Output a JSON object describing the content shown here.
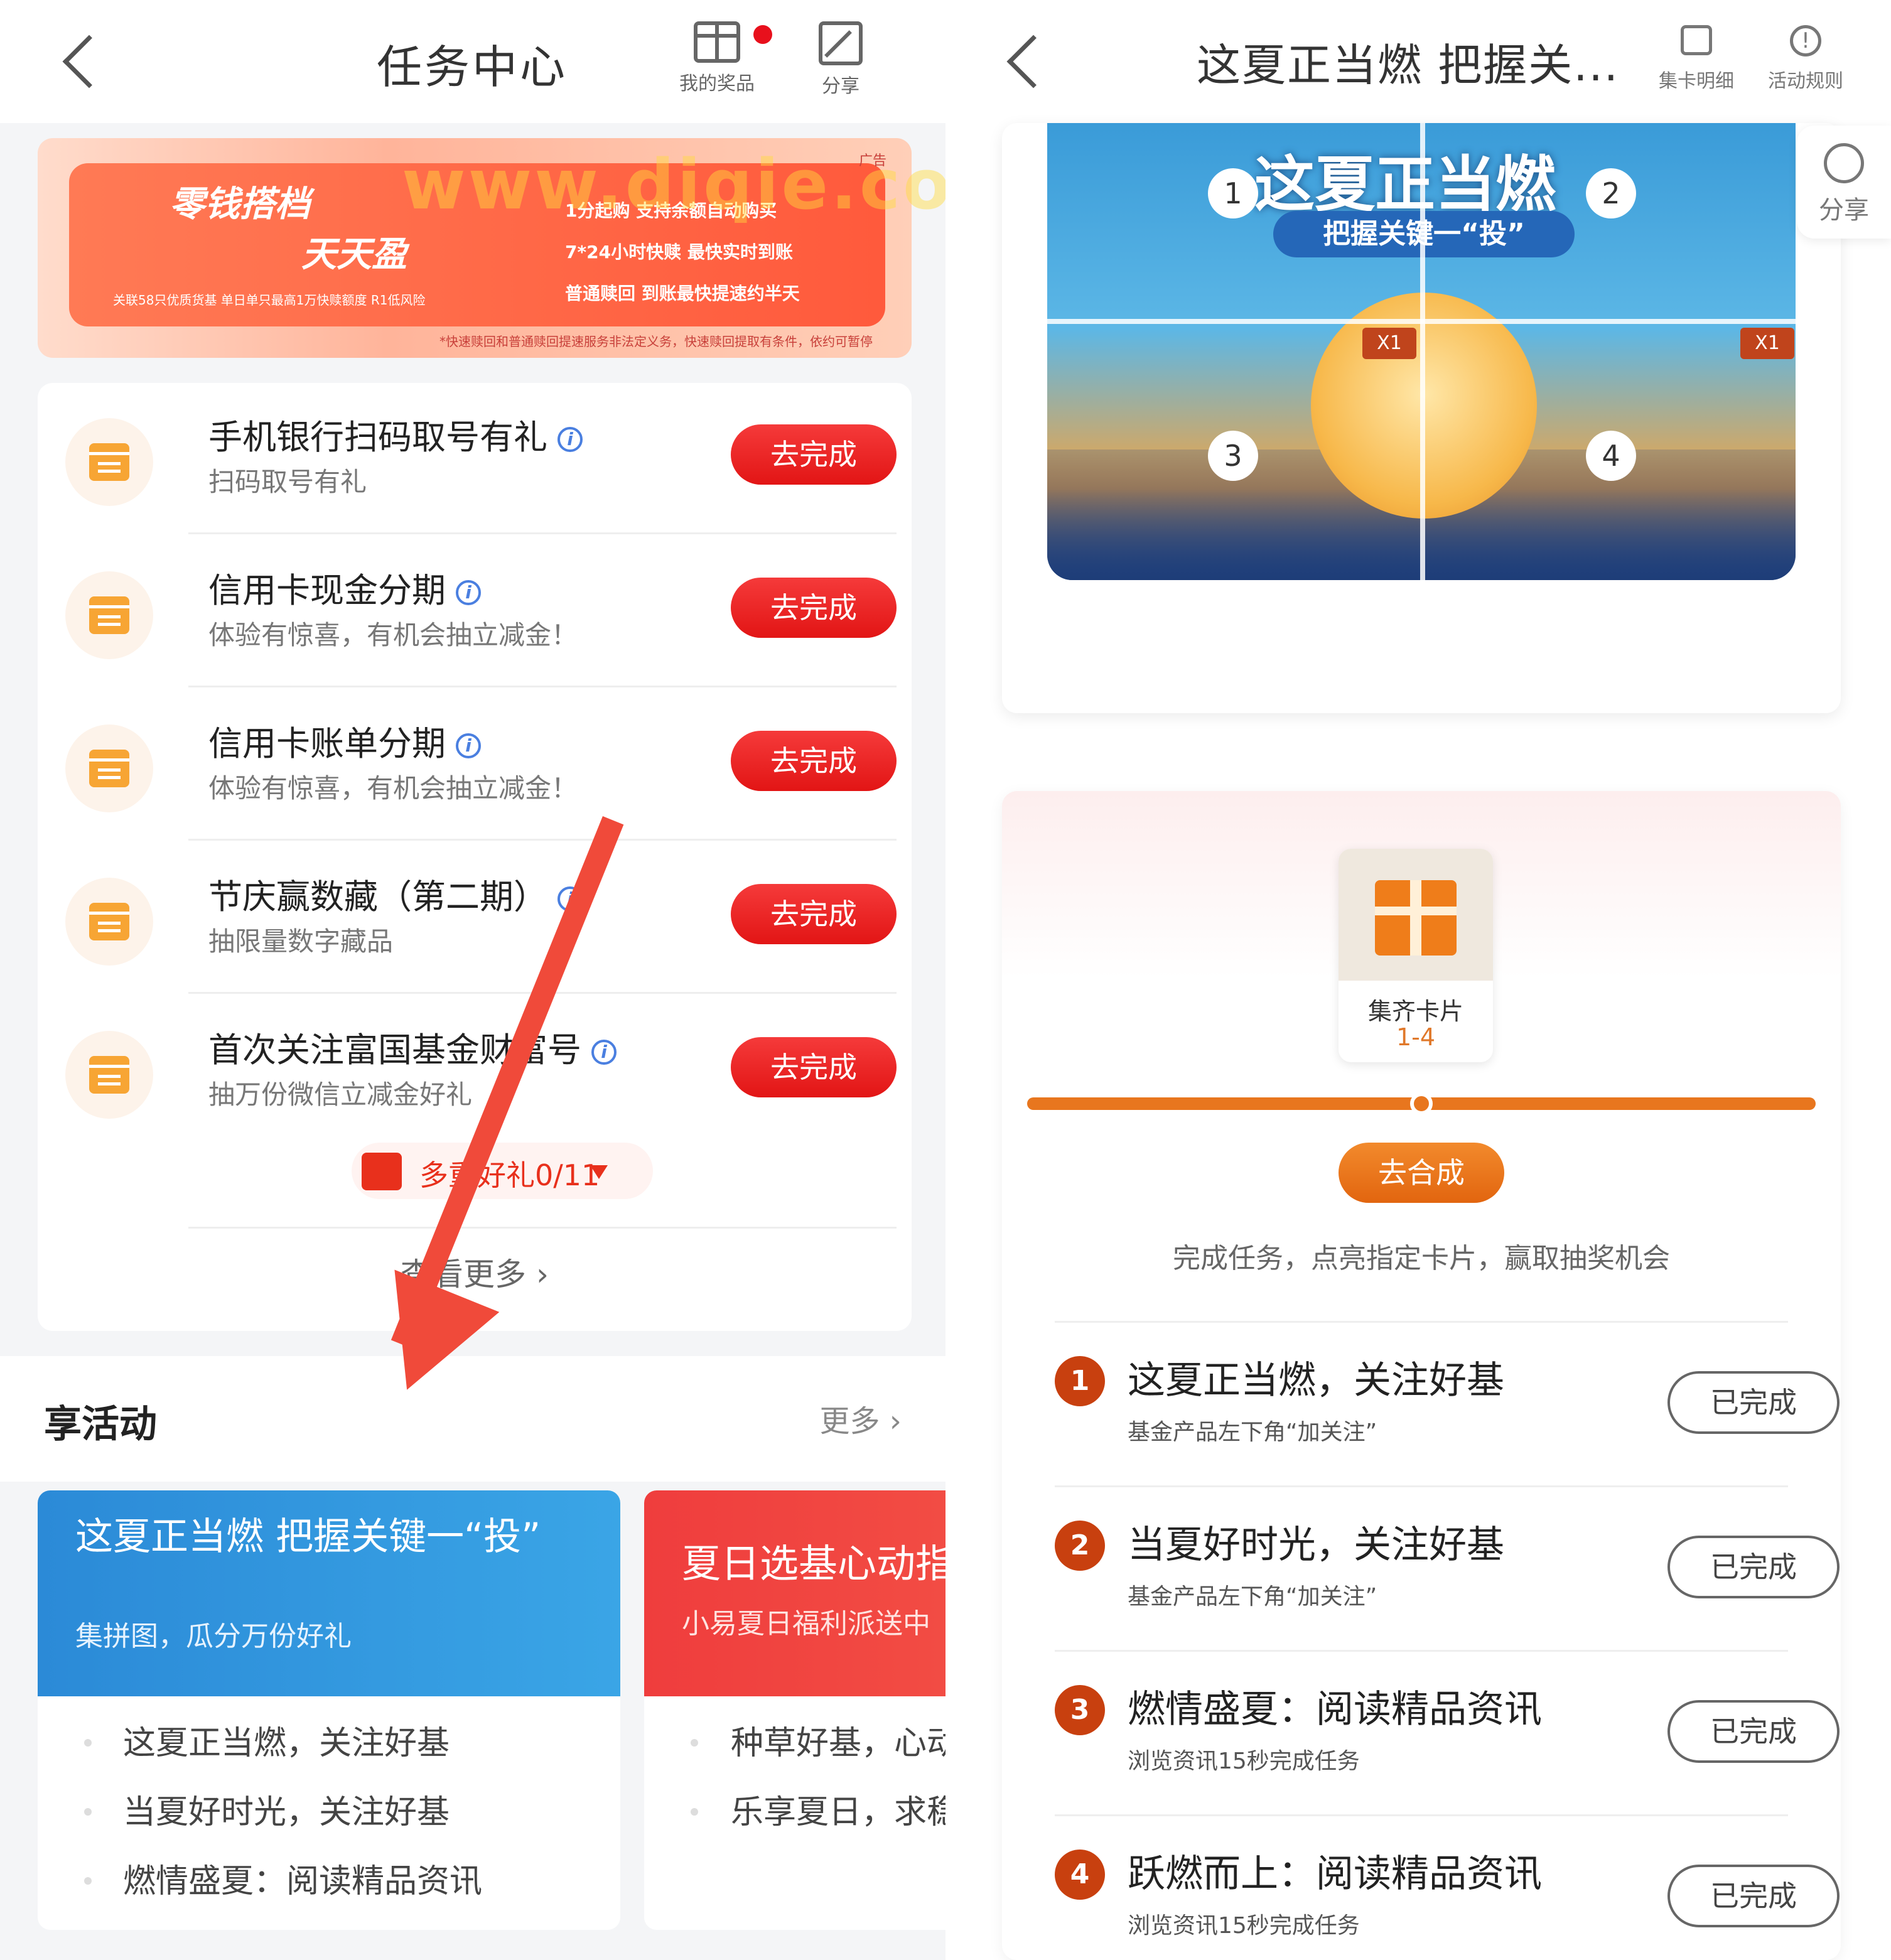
{
  "left": {
    "header": {
      "title": "任务中心",
      "prizes_label": "我的奖品",
      "share_label": "分享"
    },
    "banner": {
      "slogan1": "零钱搭档",
      "slogan2": "天天盈",
      "ad": "广告",
      "features": [
        "1分起购 支持余额自动购买",
        "7*24小时快赎 最快实时到账",
        "普通赎回 到账最快提速约半天"
      ],
      "small": "关联58只优质货基 单日单只最高1万快赎额度 R1低风险",
      "note": "*快速赎回和普通赎回提速服务非法定义务，快速赎回提取有条件，依约可暂停",
      "watermark": "www.diqie.com"
    },
    "tasks": [
      {
        "title": "手机银行扫码取号有礼",
        "sub": "扫码取号有礼",
        "btn": "去完成"
      },
      {
        "title": "信用卡现金分期",
        "sub": "体验有惊喜，有机会抽立减金！",
        "btn": "去完成"
      },
      {
        "title": "信用卡账单分期",
        "sub": "体验有惊喜，有机会抽立减金！",
        "btn": "去完成"
      },
      {
        "title": "节庆赢数藏（第二期）",
        "sub": "抽限量数字藏品",
        "btn": "去完成"
      },
      {
        "title": "首次关注富国基金财富号",
        "sub": "抽万份微信立减金好礼",
        "btn": "去完成"
      }
    ],
    "more_gift": "多重好礼0/11",
    "view_more": "查看更多 ›",
    "activities": {
      "title": "享活动",
      "more": "更多 ›",
      "cards": [
        {
          "img_title": "这夏正当燃 把握关键一“投”",
          "img_sub": "集拼图，瓜分万份好礼",
          "items": [
            "这夏正当燃，关注好基",
            "当夏好时光，关注好基",
            "燃情盛夏：阅读精品资讯"
          ]
        },
        {
          "img_title": "夏日选基心动指南",
          "img_sub": "小易夏日福利派送中",
          "items": [
            "种草好基，心动夏日",
            "乐享夏日，求稳之选"
          ]
        }
      ]
    }
  },
  "right": {
    "header": {
      "title": "这夏正当燃 把握关...",
      "detail_label": "集卡明细",
      "rules_label": "活动规则"
    },
    "side_share": "分享",
    "puzzle": {
      "title": "这夏正当燃",
      "subtitle": "把握关键一“投”",
      "pieces": [
        "1",
        "2",
        "3",
        "4"
      ],
      "counts": [
        "X1",
        "X1"
      ]
    },
    "prize": {
      "line1": "集齐卡片",
      "line2": "1-4"
    },
    "progress_fraction": 0.5,
    "compose_btn": "去合成",
    "hint": "完成任务，点亮指定卡片，赢取抽奖机会",
    "steps": [
      {
        "num": "1",
        "title": "这夏正当燃，关注好基",
        "sub": "基金产品左下角“加关注”",
        "btn": "已完成"
      },
      {
        "num": "2",
        "title": "当夏好时光，关注好基",
        "sub": "基金产品左下角“加关注”",
        "btn": "已完成"
      },
      {
        "num": "3",
        "title": "燃情盛夏：阅读精品资讯",
        "sub": "浏览资讯15秒完成任务",
        "btn": "已完成"
      },
      {
        "num": "4",
        "title": "跃燃而上：阅读精品资讯",
        "sub": "浏览资讯15秒完成任务",
        "btn": "已完成"
      }
    ]
  },
  "colors": {
    "primary_red": "#e21515",
    "accent_orange": "#e8761e",
    "link_blue": "#4a7fe0"
  }
}
